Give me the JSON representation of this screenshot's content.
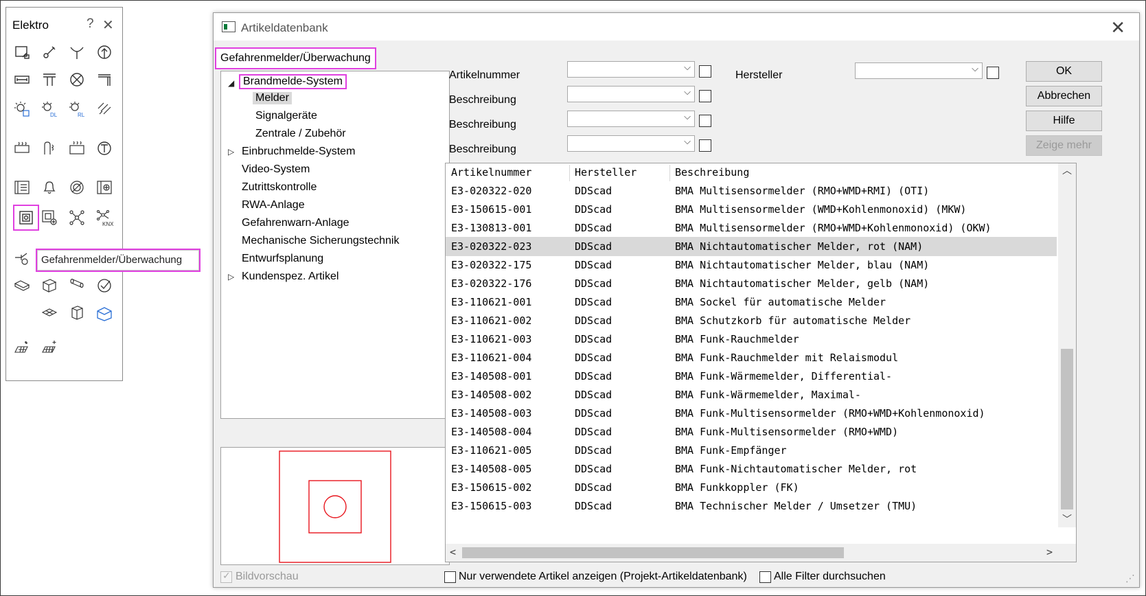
{
  "palette": {
    "title": "Elektro",
    "help_glyph": "?",
    "close_glyph": "✕",
    "tooltip": "Gefahrenmelder/Überwachung"
  },
  "dialog": {
    "title": "Artikeldatenbank",
    "close_glyph": "✕",
    "category": "Gefahrenmelder/Überwachung",
    "tree": [
      {
        "label": "Brandmelde-System",
        "toggle": "◢"
      },
      {
        "label": "Melder",
        "toggle": ""
      },
      {
        "label": "Signalgeräte",
        "toggle": ""
      },
      {
        "label": "Zentrale / Zubehör",
        "toggle": ""
      },
      {
        "label": "Einbruchmelde-System",
        "toggle": "▷"
      },
      {
        "label": "Video-System",
        "toggle": ""
      },
      {
        "label": "Zutrittskontrolle",
        "toggle": ""
      },
      {
        "label": "RWA-Anlage",
        "toggle": ""
      },
      {
        "label": "Gefahrenwarn-Anlage",
        "toggle": ""
      },
      {
        "label": "Mechanische Sicherungstechnik",
        "toggle": ""
      },
      {
        "label": "Entwurfsplanung",
        "toggle": ""
      },
      {
        "label": "Kundenspez. Artikel",
        "toggle": "▷"
      }
    ],
    "bildvorschau": "Bildvorschau",
    "filters": {
      "artikelnummer": "Artikelnummer",
      "beschreibung": "Beschreibung",
      "hersteller": "Hersteller",
      "dropdown_arrow": "⌵"
    },
    "buttons": {
      "ok": "OK",
      "abbrechen": "Abbrechen",
      "hilfe": "Hilfe",
      "zeige_mehr": "Zeige mehr"
    },
    "table": {
      "headers": [
        "Artikelnummer",
        "Hersteller",
        "Beschreibung"
      ],
      "rows": [
        [
          "E3-020322-020",
          "DDScad",
          "BMA Multisensormelder (RMO+WMD+RMI) (OTI)"
        ],
        [
          "E3-150615-001",
          "DDScad",
          "BMA Multisensormelder (WMD+Kohlenmonoxid) (MKW)"
        ],
        [
          "E3-130813-001",
          "DDScad",
          "BMA Multisensormelder (RMO+WMD+Kohlenmonoxid) (OKW)"
        ],
        [
          "E3-020322-023",
          "DDScad",
          "BMA Nichtautomatischer Melder, rot (NAM)"
        ],
        [
          "E3-020322-175",
          "DDScad",
          "BMA Nichtautomatischer Melder, blau (NAM)"
        ],
        [
          "E3-020322-176",
          "DDScad",
          "BMA Nichtautomatischer Melder, gelb (NAM)"
        ],
        [
          "E3-110621-001",
          "DDScad",
          "BMA Sockel für automatische Melder"
        ],
        [
          "E3-110621-002",
          "DDScad",
          "BMA Schutzkorb für automatische Melder"
        ],
        [
          "E3-110621-003",
          "DDScad",
          "BMA Funk-Rauchmelder"
        ],
        [
          "E3-110621-004",
          "DDScad",
          "BMA Funk-Rauchmelder mit Relaismodul"
        ],
        [
          "E3-140508-001",
          "DDScad",
          "BMA Funk-Wärmemelder, Differential-"
        ],
        [
          "E3-140508-002",
          "DDScad",
          "BMA Funk-Wärmemelder, Maximal-"
        ],
        [
          "E3-140508-003",
          "DDScad",
          "BMA Funk-Multisensormelder (RMO+WMD+Kohlenmonoxid)"
        ],
        [
          "E3-140508-004",
          "DDScad",
          "BMA Funk-Multisensormelder (RMO+WMD)"
        ],
        [
          "E3-110621-005",
          "DDScad",
          "BMA Funk-Empfänger"
        ],
        [
          "E3-140508-005",
          "DDScad",
          "BMA Funk-Nichtautomatischer Melder, rot"
        ],
        [
          "E3-150615-002",
          "DDScad",
          "BMA Funkkoppler (FK)"
        ],
        [
          "E3-150615-003",
          "DDScad",
          "BMA Technischer Melder / Umsetzer (TMU)"
        ]
      ],
      "selected_row": 3
    },
    "scroll": {
      "up": "︿",
      "down": "﹀",
      "left": "<",
      "right": ">"
    },
    "options": {
      "nur_verwendete": "Nur verwendete Artikel anzeigen (Projekt-Artikeldatenbank)",
      "alle_filter": "Alle Filter durchsuchen"
    }
  },
  "colors": {
    "highlight": "#e040e0",
    "preview_stroke": "#e8141c",
    "selection": "#d9d9d9"
  }
}
